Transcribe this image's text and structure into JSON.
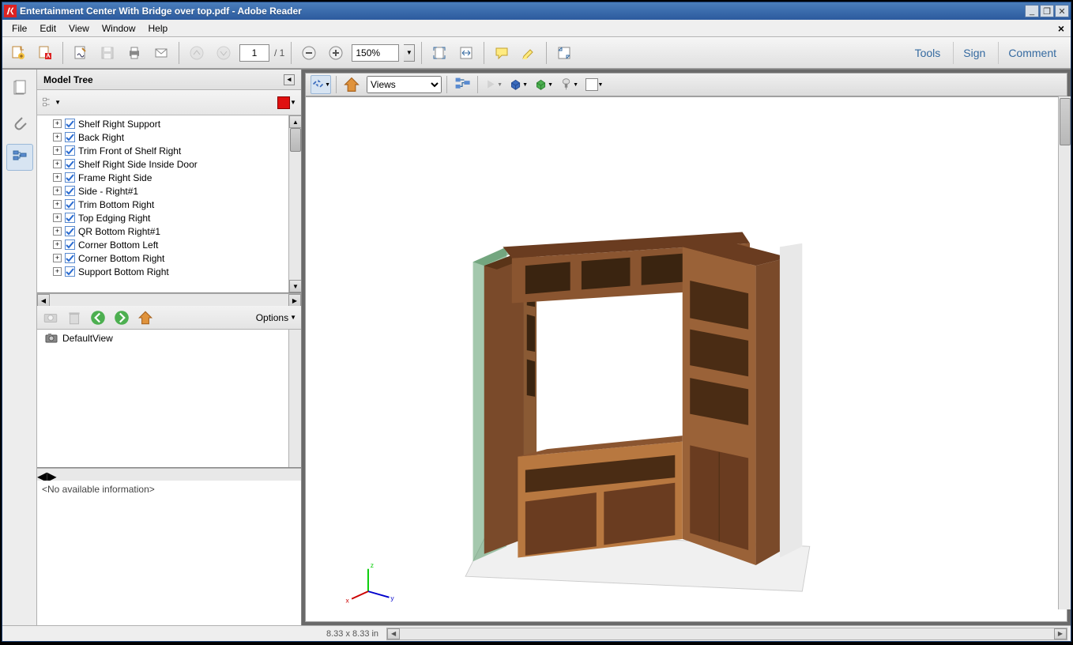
{
  "titlebar": {
    "title": "Entertainment Center With Bridge over top.pdf - Adobe Reader"
  },
  "menu": {
    "items": [
      "File",
      "Edit",
      "View",
      "Window",
      "Help"
    ]
  },
  "toolbar": {
    "page_current": "1",
    "page_total": "/ 1",
    "zoom": "150%"
  },
  "actions": {
    "tools": "Tools",
    "sign": "Sign",
    "comment": "Comment"
  },
  "panel": {
    "title": "Model Tree",
    "items": [
      "Shelf Right Support",
      "Back Right",
      "Trim Front of Shelf Right",
      "Shelf Right Side Inside Door",
      "Frame Right Side",
      "Side - Right#1",
      "Trim Bottom Right",
      "Top Edging Right",
      "QR Bottom Right#1",
      "Corner Bottom Left",
      "Corner Bottom Right",
      "Support Bottom Right"
    ],
    "options_label": "Options",
    "default_view": "DefaultView",
    "info": "<No available information>"
  },
  "viewer": {
    "views_label": "Views"
  },
  "status": {
    "dims": "8.33 x 8.33 in"
  },
  "icons": {
    "minimize": "_",
    "restore": "❐",
    "close": "✕"
  }
}
